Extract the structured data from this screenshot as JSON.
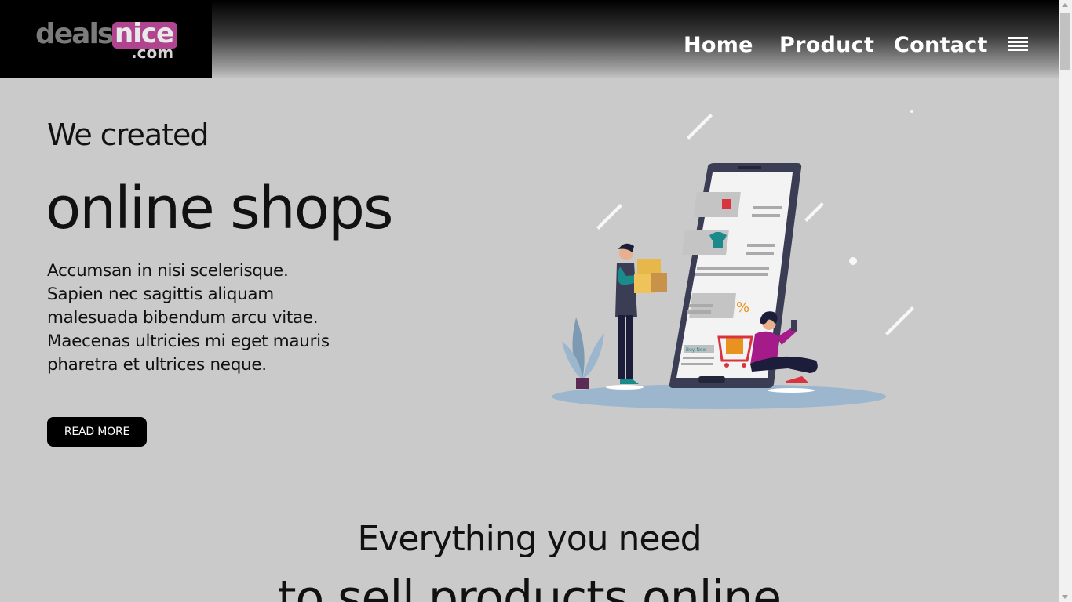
{
  "header": {
    "logo": {
      "word": "deals",
      "highlight": "nice",
      "suffix": ".com",
      "accent_color": "#b0448e"
    },
    "nav": [
      {
        "label": "Home"
      },
      {
        "label": "Product"
      },
      {
        "label": "Contact"
      }
    ],
    "menu_icon": "hamburger-menu-icon"
  },
  "hero": {
    "line1": "We created",
    "line2": "online shops",
    "paragraph_lines": [
      "Accumsan in nisi scelerisque.",
      "Sapien nec sagittis aliquam",
      "malesuada bibendum arcu vitae.",
      "Maecenas ultricies mi eget mauris",
      "pharetra et ultrices neque."
    ],
    "button_label": "READ MORE",
    "illustration": {
      "buy_now_label": "Buy Now",
      "percent_label": "%"
    }
  },
  "section": {
    "title": "Everything you need",
    "subtitle": "to sell products online"
  }
}
